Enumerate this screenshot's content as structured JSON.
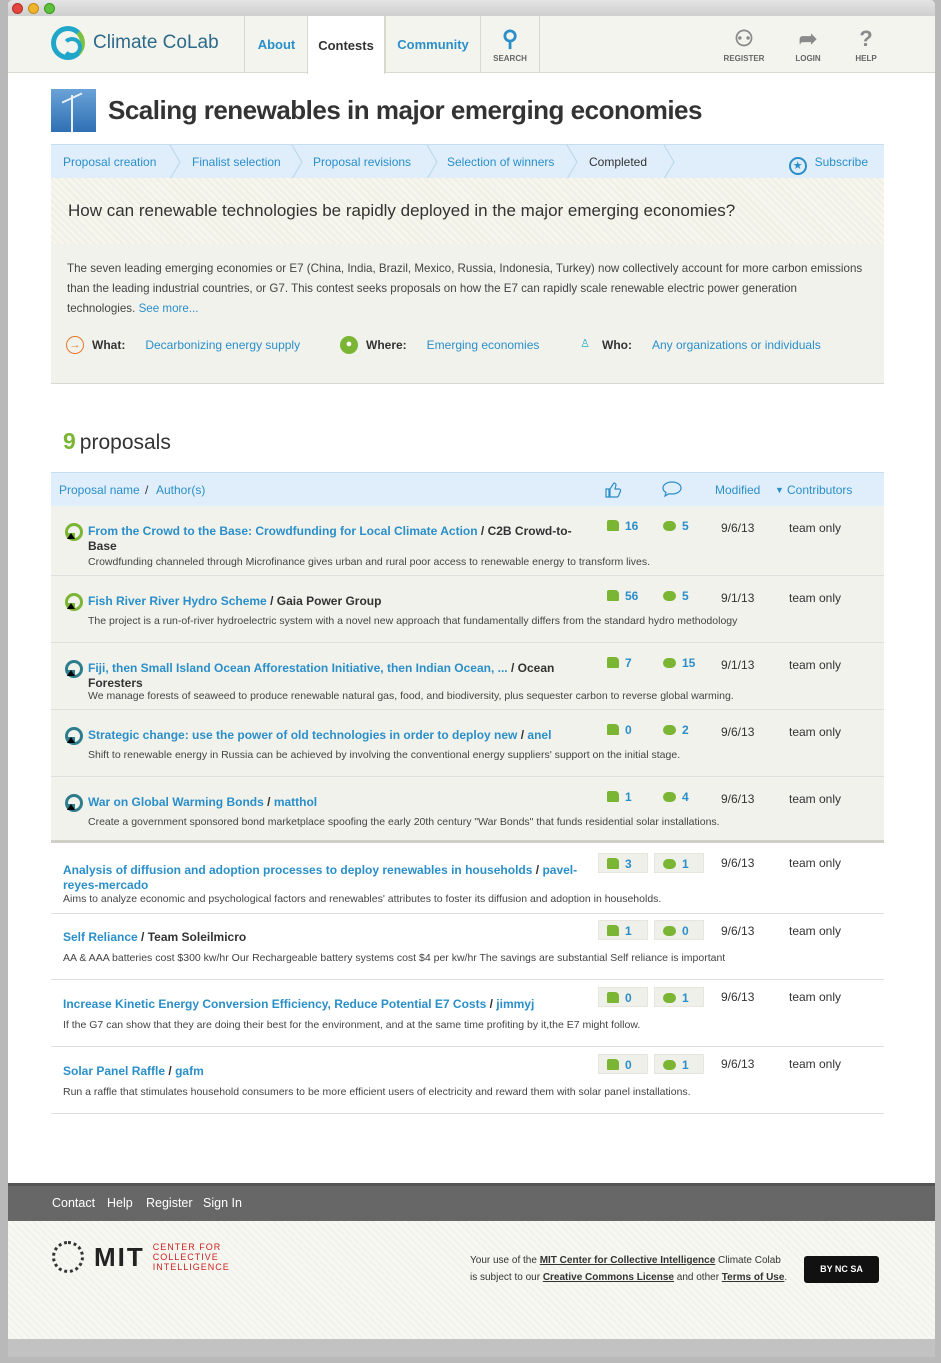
{
  "header": {
    "logo_text": "Climate CoLab",
    "tabs": [
      "About",
      "Contests",
      "Community"
    ],
    "search_label": "SEARCH",
    "register_label": "REGISTER",
    "login_label": "LOGIN",
    "help_label": "HELP"
  },
  "contest": {
    "title": "Scaling renewables in major emerging economies",
    "phases": [
      "Proposal creation",
      "Finalist selection",
      "Proposal revisions",
      "Selection of winners",
      "Completed"
    ],
    "subscribe": "Subscribe",
    "question": "How can renewable technologies be rapidly deployed in the major emerging economies?",
    "description": "The seven leading emerging economies or E7 (China, India, Brazil, Mexico, Russia, Indonesia, Turkey) now collectively account for more carbon emissions than the leading industrial countries, or G7. This contest seeks proposals on how the E7 can rapidly scale renewable electric power generation technologies.",
    "see_more": "See more...",
    "what_label": "What:",
    "what_value": "Decarbonizing energy supply",
    "where_label": "Where:",
    "where_value": "Emerging economies",
    "who_label": "Who:",
    "who_value": "Any organizations or individuals"
  },
  "proposals": {
    "count": "9",
    "count_label": "proposals",
    "columns": {
      "name": "Proposal name",
      "author": "Author(s)",
      "modified": "Modified",
      "contributors": "Contributors"
    },
    "rows": [
      {
        "title": "From the Crowd to the Base: Crowdfunding for Local Climate Action",
        "author": "C2B Crowd-to-Base",
        "author_link": false,
        "desc": "Crowdfunding channeled through Microfinance gives urban and rural poor access to renewable energy to transform lives.",
        "votes": "16",
        "comments": "5",
        "modified": "9/6/13",
        "contributors": "team only",
        "finalist": true,
        "ribbon": "#7ab534"
      },
      {
        "title": "Fish River River Hydro Scheme",
        "author": "Gaia Power Group",
        "author_link": false,
        "desc": "The project is a run-of-river hydroelectric system with a novel new approach that fundamentally differs from the standard hydro methodology",
        "votes": "56",
        "comments": "5",
        "modified": "9/1/13",
        "contributors": "team only",
        "finalist": true,
        "ribbon": "#7ab534"
      },
      {
        "title": "Fiji, then Small Island Ocean Afforestation Initiative, then Indian Ocean, ...",
        "author": "Ocean Foresters",
        "author_link": false,
        "desc": "We manage forests of seaweed to produce renewable natural gas, food, and biodiversity, plus sequester carbon to reverse global warming.",
        "votes": "7",
        "comments": "15",
        "modified": "9/1/13",
        "contributors": "team only",
        "finalist": true,
        "ribbon": "#2d7d8c"
      },
      {
        "title": "Strategic change: use the power of old technologies in order to deploy new",
        "author": "anel",
        "author_link": true,
        "desc": "Shift to renewable energy in Russia can be achieved by involving the conventional energy suppliers' support on the initial stage.",
        "votes": "0",
        "comments": "2",
        "modified": "9/6/13",
        "contributors": "team only",
        "finalist": true,
        "ribbon": "#2d7d8c"
      },
      {
        "title": "War on Global Warming Bonds",
        "author": "matthol",
        "author_link": true,
        "desc": "Create a government sponsored bond marketplace spoofing the early 20th century \"War Bonds\" that funds residential solar installations.",
        "votes": "1",
        "comments": "4",
        "modified": "9/6/13",
        "contributors": "team only",
        "finalist": true,
        "ribbon": "#2d7d8c"
      },
      {
        "title": "Analysis of diffusion and adoption processes to deploy renewables in households",
        "author": "pavel-reyes-mercado",
        "author_link": true,
        "desc": "Aims to analyze economic and psychological factors and renewables' attributes to foster its diffusion and adoption in households.",
        "votes": "3",
        "comments": "1",
        "modified": "9/6/13",
        "contributors": "team only",
        "finalist": false
      },
      {
        "title": "Self Reliance",
        "author": "Team Soleilmicro",
        "author_link": false,
        "desc": "AA & AAA batteries cost $300 kw/hr Our Rechargeable battery systems cost $4 per kw/hr The savings are substantial Self reliance is important",
        "votes": "1",
        "comments": "0",
        "modified": "9/6/13",
        "contributors": "team only",
        "finalist": false
      },
      {
        "title": "Increase Kinetic Energy Conversion Efficiency, Reduce Potential E7 Costs",
        "author": "jimmyj",
        "author_link": true,
        "desc": "If the G7 can show that they are doing their best for the environment, and at the same time profiting by it,the E7 might follow.",
        "votes": "0",
        "comments": "1",
        "modified": "9/6/13",
        "contributors": "team only",
        "finalist": false
      },
      {
        "title": "Solar Panel Raffle",
        "author": "gafm",
        "author_link": true,
        "desc": "Run a raffle that stimulates household consumers to be more efficient users of electricity and reward them with solar panel installations.",
        "votes": "0",
        "comments": "1",
        "modified": "9/6/13",
        "contributors": "team only",
        "finalist": false
      }
    ]
  },
  "footer": {
    "links": [
      "Contact",
      "Help",
      "Register",
      "Sign In"
    ],
    "center_text": "CENTER FOR COLLECTIVE INTELLIGENCE",
    "mit": "MIT",
    "legal_line1_pre": "Your use of the ",
    "legal_link1": "MIT Center for Collective Intelligence",
    "legal_line1_post": " Climate Colab",
    "legal_line2_pre": "is subject to our ",
    "legal_link2": "Creative Commons License",
    "legal_line2_mid": " and other ",
    "legal_link3": "Terms of Use",
    "legal_line2_post": ".",
    "cc_badge": "BY NC SA"
  },
  "colors": {
    "accent": "#2a8fc9",
    "green": "#7ab534",
    "brand": "#1fa6c9"
  }
}
